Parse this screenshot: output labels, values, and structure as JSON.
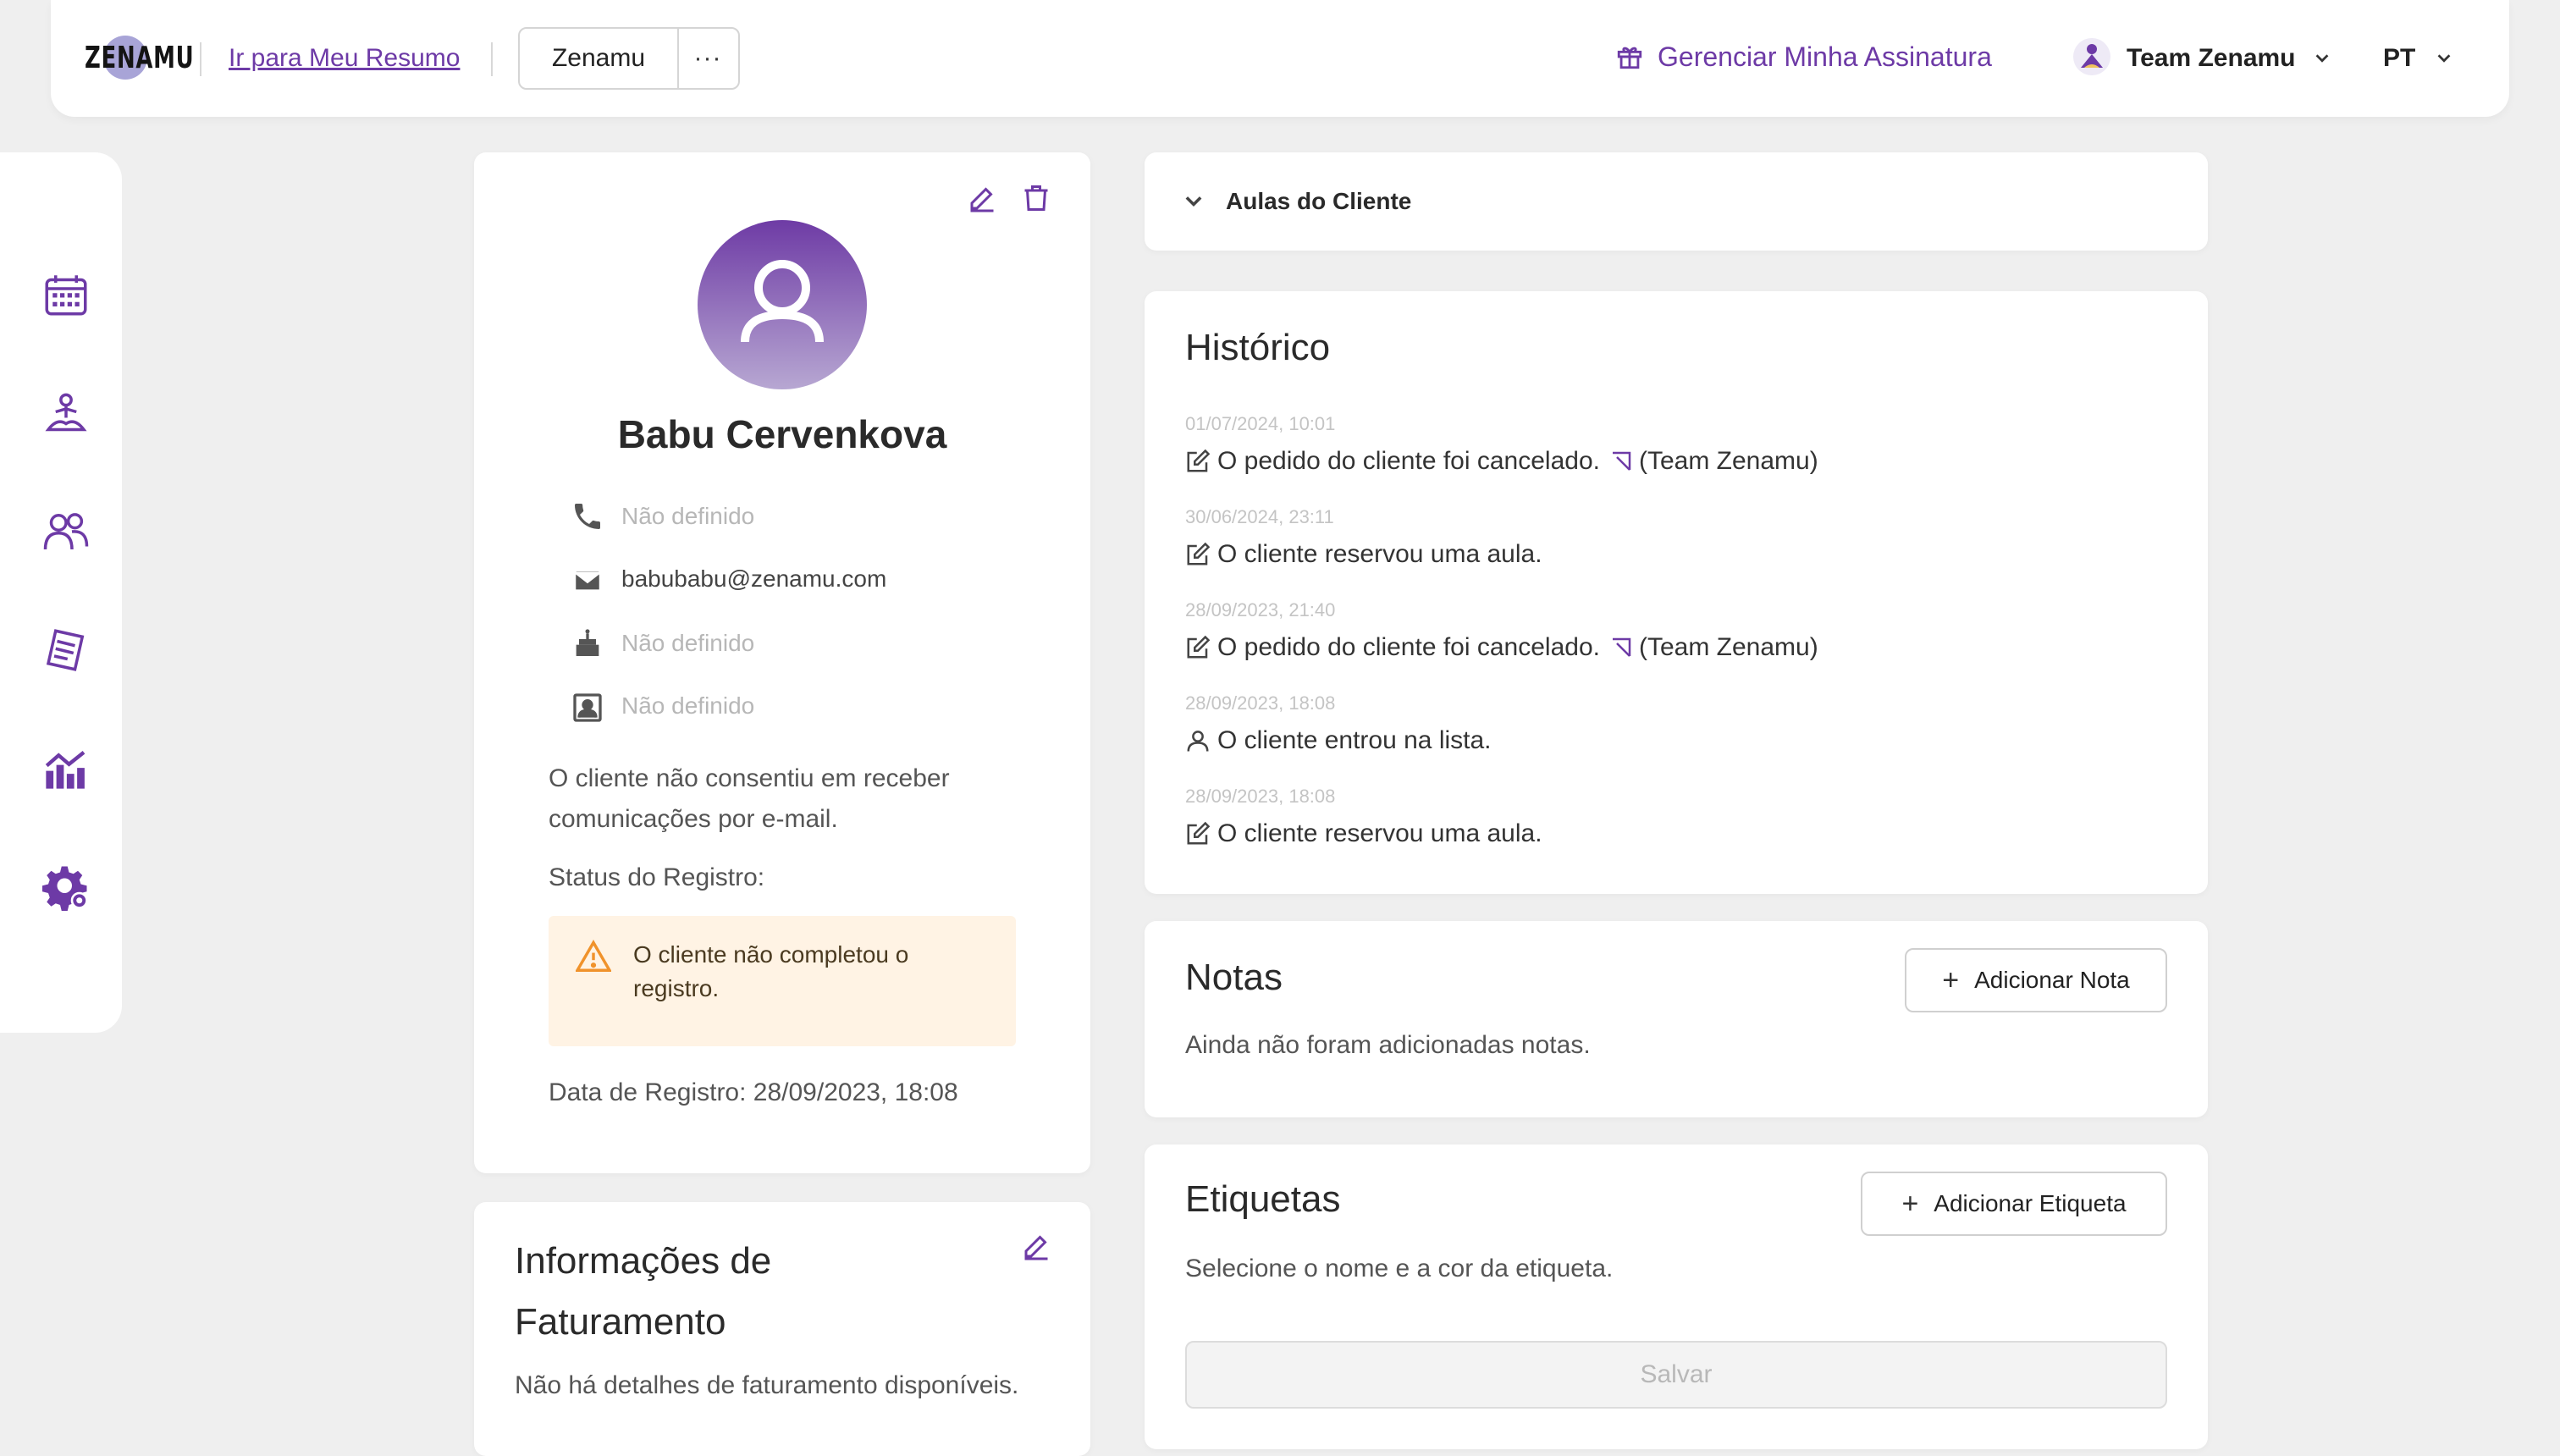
{
  "header": {
    "logo_text": "ZENAMU",
    "resumo_link": "Ir para Meu Resumo",
    "studio_button": "Zenamu",
    "more_button": "···",
    "subscription_link": "Gerenciar Minha Assinatura",
    "user_name": "Team Zenamu",
    "language": "PT",
    "accent_color": "#6d3aa6"
  },
  "sidebar": {
    "items": [
      {
        "icon": "calendar-icon"
      },
      {
        "icon": "meditation-icon"
      },
      {
        "icon": "clients-icon"
      },
      {
        "icon": "documents-icon"
      },
      {
        "icon": "analytics-icon"
      },
      {
        "icon": "settings-icon"
      }
    ]
  },
  "profile": {
    "name": "Babu Cervenkova",
    "phone": "Não definido",
    "email": "babubabu@zenamu.com",
    "birthday": "Não definido",
    "id_number": "Não definido",
    "consent_text": "O cliente não consentiu em receber comunicações por e-mail.",
    "status_label": "Status do Registro:",
    "warning_text": "O cliente não completou o registro.",
    "registration_date": "Data de Registro: 28/09/2023, 18:08"
  },
  "billing": {
    "title": "Informações de Faturamento",
    "text": "Não há detalhes de faturamento disponíveis."
  },
  "aulas": {
    "title": "Aulas do Cliente"
  },
  "history": {
    "title": "Histórico",
    "entries": [
      {
        "date": "01/07/2024, 10:01",
        "text": "O pedido do cliente foi cancelado.",
        "by": "(Team Zenamu)"
      },
      {
        "date": "30/06/2024, 23:11",
        "text": "O cliente reservou uma aula."
      },
      {
        "date": "28/09/2023, 21:40",
        "text": "O pedido do cliente foi cancelado.",
        "by": "(Team Zenamu)"
      },
      {
        "date": "28/09/2023, 18:08",
        "text": "O cliente entrou na lista."
      },
      {
        "date": "28/09/2023, 18:08",
        "text": "O cliente reservou uma aula."
      }
    ]
  },
  "notes": {
    "title": "Notas",
    "add_button": "Adicionar Nota",
    "empty_text": "Ainda não foram adicionadas notas."
  },
  "tags": {
    "title": "Etiquetas",
    "add_button": "Adicionar Etiqueta",
    "hint": "Selecione o nome e a cor da etiqueta.",
    "save_button": "Salvar"
  }
}
